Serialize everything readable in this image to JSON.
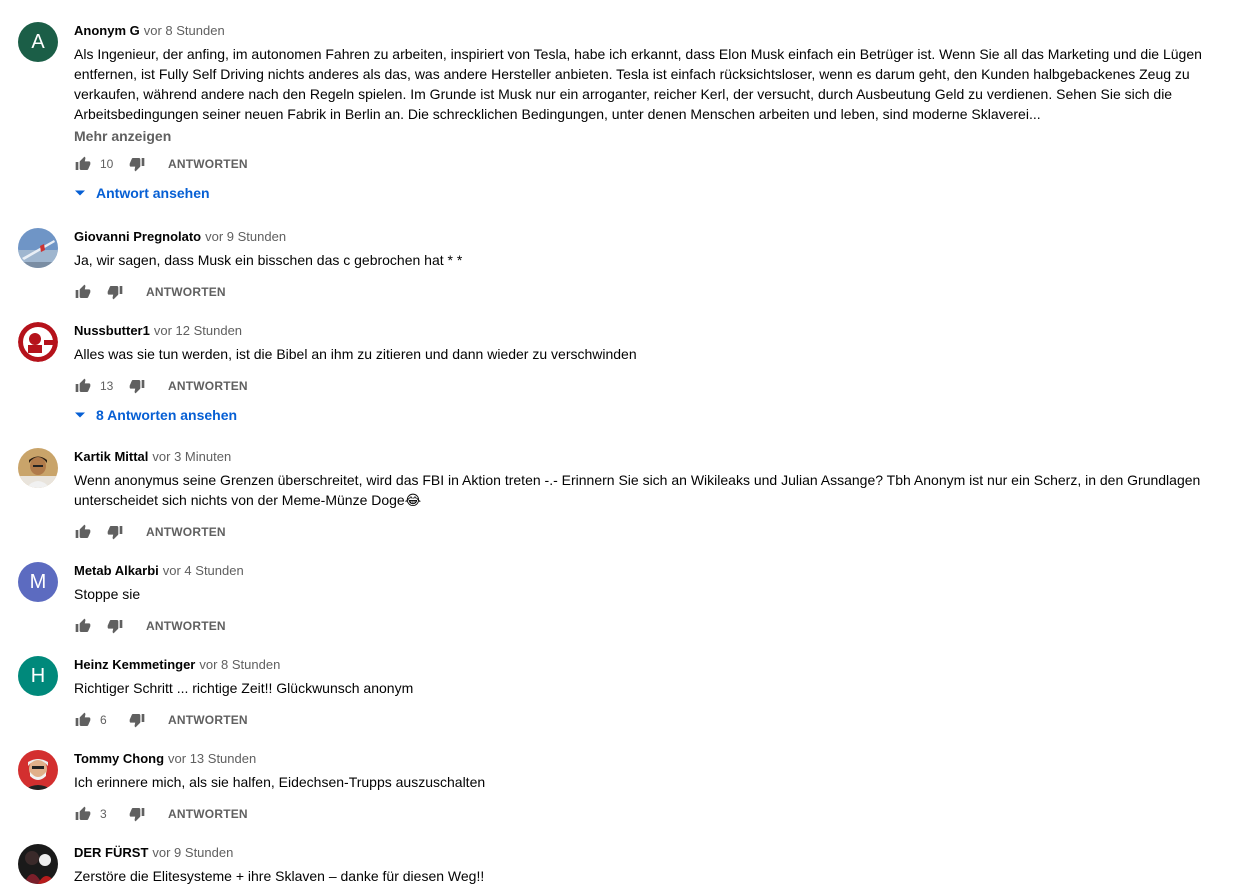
{
  "labels": {
    "reply": "ANTWORTEN",
    "show_more": "Mehr anzeigen"
  },
  "comments": [
    {
      "author": "Anonym G",
      "time": "vor 8 Stunden",
      "avatar_letter": "A",
      "avatar_color": "#1b5e47",
      "text": "Als Ingenieur, der anfing, im autonomen Fahren zu arbeiten, inspiriert von Tesla, habe ich erkannt, dass Elon Musk einfach ein Betrüger ist. Wenn Sie all das Marketing und die Lügen entfernen, ist Fully Self Driving nichts anderes als das, was andere Hersteller anbieten. Tesla ist einfach rücksichtsloser, wenn es darum geht, den Kunden halbgebackenes Zeug zu verkaufen, während andere nach den Regeln spielen. Im Grunde ist Musk nur ein arroganter, reicher Kerl, der versucht, durch Ausbeutung Geld zu verdienen. Sehen Sie sich die Arbeitsbedingungen seiner neuen Fabrik in Berlin an. Die schrecklichen Bedingungen, unter denen Menschen arbeiten und leben, sind moderne Sklaverei...",
      "likes": "10",
      "replies_label": "Antwort ansehen"
    },
    {
      "author": "Giovanni Pregnolato",
      "time": "vor 9 Stunden",
      "avatar_icon": "photo-sky-avatar",
      "text": "Ja, wir sagen, dass Musk ein bisschen das c gebrochen hat * *",
      "likes": ""
    },
    {
      "author": "Nussbutter1",
      "time": "vor 12 Stunden",
      "avatar_icon": "kfc-logo-avatar",
      "text": "Alles was sie tun werden, ist die Bibel an ihm zu zitieren und dann wieder zu verschwinden",
      "likes": "13",
      "replies_label": "8 Antworten ansehen"
    },
    {
      "author": "Kartik Mittal",
      "time": "vor 3 Minuten",
      "avatar_icon": "person-photo-avatar",
      "text": "Wenn anonymus seine Grenzen überschreitet, wird das FBI in Aktion treten -.- Erinnern Sie sich an Wikileaks und Julian Assange? Tbh Anonym ist nur ein Scherz, in den Grundlagen unterscheidet sich nichts von der Meme-Münze Doge😂",
      "likes": ""
    },
    {
      "author": "Metab Alkarbi",
      "time": "vor 4 Stunden",
      "avatar_letter": "M",
      "avatar_color": "#5c6bc0",
      "text": "Stoppe sie",
      "likes": ""
    },
    {
      "author": "Heinz Kemmetinger",
      "time": "vor 8 Stunden",
      "avatar_letter": "H",
      "avatar_color": "#00897b",
      "text": "Richtiger Schritt ... richtige Zeit!! Glückwunsch anonym",
      "likes": "6"
    },
    {
      "author": "Tommy Chong",
      "time": "vor 13 Stunden",
      "avatar_icon": "person-red-bg-avatar",
      "text": "Ich erinnere mich, als sie halfen, Eidechsen-Trupps auszuschalten",
      "likes": "3"
    },
    {
      "author": "DER FÜRST",
      "time": "vor 9 Stunden",
      "avatar_icon": "dark-figure-avatar",
      "text": "Zerstöre die Elitesysteme + ihre Sklaven – danke für diesen Weg!!",
      "likes": ""
    }
  ],
  "colors": {
    "link_blue": "#065fd4",
    "secondary_text": "#606060",
    "primary_text": "#030303"
  }
}
